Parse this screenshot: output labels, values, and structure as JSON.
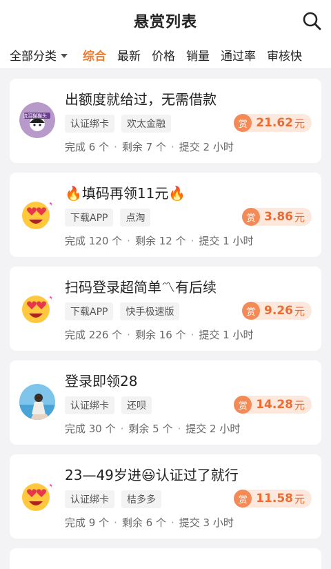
{
  "header": {
    "title": "悬赏列表",
    "search_icon": "search-icon"
  },
  "filters": {
    "category_label": "全部分类",
    "tabs": [
      "综合",
      "最新",
      "价格",
      "销量",
      "通过率",
      "审核快"
    ],
    "active_tab": 0
  },
  "accent": "#f07a2d",
  "cards": [
    {
      "title": "出额度就给过，无需借款",
      "tags": [
        "认证绑卡",
        "欢太金融"
      ],
      "reward_badge": "赏",
      "reward": "21.62",
      "unit": "元",
      "done": "完成 6 个",
      "remain": "剩余 7 个",
      "submit": "提交 2 小时",
      "avatar": "avatar-text",
      "avatar_text": "流泪猫猫头"
    },
    {
      "title": "🔥填码再领11元🔥",
      "tags": [
        "下载APP",
        "点淘"
      ],
      "reward_badge": "赏",
      "reward": "3.86",
      "unit": "元",
      "done": "完成 120 个",
      "remain": "剩余 12 个",
      "submit": "提交 1 小时",
      "avatar": "heart-eyes-emoji-icon"
    },
    {
      "title": "扫码登录超简单〽有后续",
      "tags": [
        "下载APP",
        "快手极速版"
      ],
      "reward_badge": "赏",
      "reward": "9.26",
      "unit": "元",
      "done": "完成 226 个",
      "remain": "剩余 16 个",
      "submit": "提交 1 小时",
      "avatar": "heart-eyes-emoji-icon"
    },
    {
      "title": "登录即领28",
      "tags": [
        "认证绑卡",
        "还呗"
      ],
      "reward_badge": "赏",
      "reward": "14.28",
      "unit": "元",
      "done": "完成 30 个",
      "remain": "剩余 5 个",
      "submit": "提交 2 小时",
      "avatar": "photo-avatar"
    },
    {
      "title": "23—49岁进😃认证过了就行",
      "tags": [
        "认证绑卡",
        "桔多多"
      ],
      "reward_badge": "赏",
      "reward": "11.58",
      "unit": "元",
      "done": "完成 9 个",
      "remain": "剩余 6 个",
      "submit": "提交 3 小时",
      "avatar": "heart-eyes-emoji-icon"
    }
  ]
}
